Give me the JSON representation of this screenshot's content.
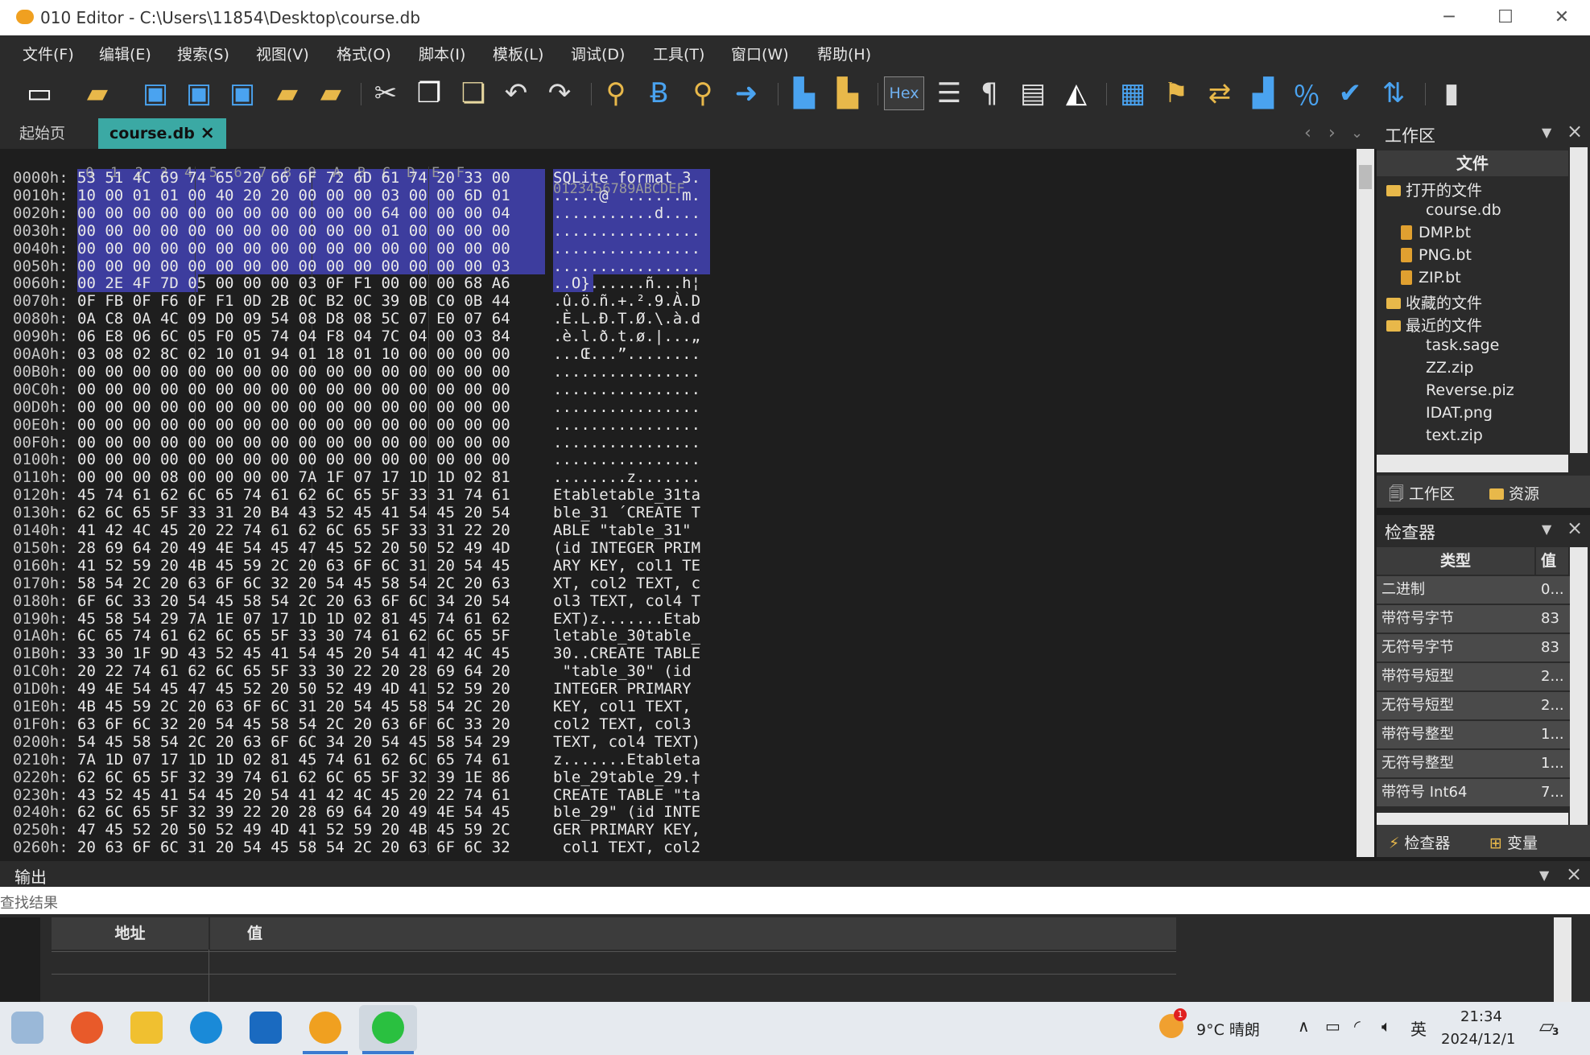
{
  "window": {
    "title": "010 Editor - C:\\Users\\11854\\Desktop\\course.db"
  },
  "menu": [
    "文件(F)",
    "编辑(E)",
    "搜索(S)",
    "视图(V)",
    "格式(O)",
    "脚本(I)",
    "模板(L)",
    "调试(D)",
    "工具(T)",
    "窗口(W)",
    "帮助(H)"
  ],
  "toolbar": {
    "hex_label": "Hex"
  },
  "tabs": {
    "start": "起始页",
    "active": "course.db",
    "close_glyph": "×"
  },
  "hex": {
    "header_bytes": " 0  1  2  3  4  5  6  7  8  9  A  B  C  D  E  F",
    "header_ascii": "0123456789ABCDEF",
    "rows": [
      {
        "a": "0000h:",
        "h": "53 51 4C 69 74 65 20 66 6F 72 6D 61 74 20 33 00",
        "t": "SQLite format 3."
      },
      {
        "a": "0010h:",
        "h": "10 00 01 01 00 40 20 20 00 00 00 03 00 00 6D 01",
        "t": ".....@  ......m."
      },
      {
        "a": "0020h:",
        "h": "00 00 00 00 00 00 00 00 00 00 00 64 00 00 00 04",
        "t": "...........d...."
      },
      {
        "a": "0030h:",
        "h": "00 00 00 00 00 00 00 00 00 00 00 01 00 00 00 00",
        "t": "................"
      },
      {
        "a": "0040h:",
        "h": "00 00 00 00 00 00 00 00 00 00 00 00 00 00 00 00",
        "t": "................"
      },
      {
        "a": "0050h:",
        "h": "00 00 00 00 00 00 00 00 00 00 00 00 00 00 00 03",
        "t": "................"
      },
      {
        "a": "0060h:",
        "h": "00 2E 4F 7D 05 00 00 00 03 0F F1 00 00 00 68 A6",
        "t": "..O}......ñ...h¦"
      },
      {
        "a": "0070h:",
        "h": "0F FB 0F F6 0F F1 0D 2B 0C B2 0C 39 0B C0 0B 44",
        "t": ".û.ö.ñ.+.².9.À.D"
      },
      {
        "a": "0080h:",
        "h": "0A C8 0A 4C 09 D0 09 54 08 D8 08 5C 07 E0 07 64",
        "t": ".È.L.Ð.T.Ø.\\.à.d"
      },
      {
        "a": "0090h:",
        "h": "06 E8 06 6C 05 F0 05 74 04 F8 04 7C 04 00 03 84",
        "t": ".è.l.ð.t.ø.|...„"
      },
      {
        "a": "00A0h:",
        "h": "03 08 02 8C 02 10 01 94 01 18 01 10 00 00 00 00",
        "t": "...Œ...”........"
      },
      {
        "a": "00B0h:",
        "h": "00 00 00 00 00 00 00 00 00 00 00 00 00 00 00 00",
        "t": "................"
      },
      {
        "a": "00C0h:",
        "h": "00 00 00 00 00 00 00 00 00 00 00 00 00 00 00 00",
        "t": "................"
      },
      {
        "a": "00D0h:",
        "h": "00 00 00 00 00 00 00 00 00 00 00 00 00 00 00 00",
        "t": "................"
      },
      {
        "a": "00E0h:",
        "h": "00 00 00 00 00 00 00 00 00 00 00 00 00 00 00 00",
        "t": "................"
      },
      {
        "a": "00F0h:",
        "h": "00 00 00 00 00 00 00 00 00 00 00 00 00 00 00 00",
        "t": "................"
      },
      {
        "a": "0100h:",
        "h": "00 00 00 00 00 00 00 00 00 00 00 00 00 00 00 00",
        "t": "................"
      },
      {
        "a": "0110h:",
        "h": "00 00 00 08 00 00 00 00 7A 1F 07 17 1D 1D 02 81",
        "t": "........z......."
      },
      {
        "a": "0120h:",
        "h": "45 74 61 62 6C 65 74 61 62 6C 65 5F 33 31 74 61",
        "t": "Etabletable_31ta"
      },
      {
        "a": "0130h:",
        "h": "62 6C 65 5F 33 31 20 B4 43 52 45 41 54 45 20 54",
        "t": "ble_31 ´CREATE T"
      },
      {
        "a": "0140h:",
        "h": "41 42 4C 45 20 22 74 61 62 6C 65 5F 33 31 22 20",
        "t": "ABLE \"table_31\" "
      },
      {
        "a": "0150h:",
        "h": "28 69 64 20 49 4E 54 45 47 45 52 20 50 52 49 4D",
        "t": "(id INTEGER PRIM"
      },
      {
        "a": "0160h:",
        "h": "41 52 59 20 4B 45 59 2C 20 63 6F 6C 31 20 54 45",
        "t": "ARY KEY, col1 TE"
      },
      {
        "a": "0170h:",
        "h": "58 54 2C 20 63 6F 6C 32 20 54 45 58 54 2C 20 63",
        "t": "XT, col2 TEXT, c"
      },
      {
        "a": "0180h:",
        "h": "6F 6C 33 20 54 45 58 54 2C 20 63 6F 6C 34 20 54",
        "t": "ol3 TEXT, col4 T"
      },
      {
        "a": "0190h:",
        "h": "45 58 54 29 7A 1E 07 17 1D 1D 02 81 45 74 61 62",
        "t": "EXT)z.......Etab"
      },
      {
        "a": "01A0h:",
        "h": "6C 65 74 61 62 6C 65 5F 33 30 74 61 62 6C 65 5F",
        "t": "letable_30table_"
      },
      {
        "a": "01B0h:",
        "h": "33 30 1F 9D 43 52 45 41 54 45 20 54 41 42 4C 45",
        "t": "30..CREATE TABLE"
      },
      {
        "a": "01C0h:",
        "h": "20 22 74 61 62 6C 65 5F 33 30 22 20 28 69 64 20",
        "t": " \"table_30\" (id "
      },
      {
        "a": "01D0h:",
        "h": "49 4E 54 45 47 45 52 20 50 52 49 4D 41 52 59 20",
        "t": "INTEGER PRIMARY "
      },
      {
        "a": "01E0h:",
        "h": "4B 45 59 2C 20 63 6F 6C 31 20 54 45 58 54 2C 20",
        "t": "KEY, col1 TEXT, "
      },
      {
        "a": "01F0h:",
        "h": "63 6F 6C 32 20 54 45 58 54 2C 20 63 6F 6C 33 20",
        "t": "col2 TEXT, col3 "
      },
      {
        "a": "0200h:",
        "h": "54 45 58 54 2C 20 63 6F 6C 34 20 54 45 58 54 29",
        "t": "TEXT, col4 TEXT)"
      },
      {
        "a": "0210h:",
        "h": "7A 1D 07 17 1D 1D 02 81 45 74 61 62 6C 65 74 61",
        "t": "z.......Etableta"
      },
      {
        "a": "0220h:",
        "h": "62 6C 65 5F 32 39 74 61 62 6C 65 5F 32 39 1E 86",
        "t": "ble_29table_29.†"
      },
      {
        "a": "0230h:",
        "h": "43 52 45 41 54 45 20 54 41 42 4C 45 20 22 74 61",
        "t": "CREATE TABLE \"ta"
      },
      {
        "a": "0240h:",
        "h": "62 6C 65 5F 32 39 22 20 28 69 64 20 49 4E 54 45",
        "t": "ble_29\" (id INTE"
      },
      {
        "a": "0250h:",
        "h": "47 45 52 20 50 52 49 4D 41 52 59 20 4B 45 59 2C",
        "t": "GER PRIMARY KEY,"
      },
      {
        "a": "0260h:",
        "h": "20 63 6F 6C 31 20 54 45 58 54 2C 20 63 6F 6C 32",
        "t": " col1 TEXT, col2"
      }
    ]
  },
  "workspace": {
    "title": "工作区",
    "header": "文件",
    "open_files_label": "打开的文件",
    "open_files": [
      "course.db",
      "DMP.bt",
      "PNG.bt",
      "ZIP.bt"
    ],
    "favorites_label": "收藏的文件",
    "recent_label": "最近的文件",
    "recent": [
      "task.sage",
      "ZZ.zip",
      "Reverse.piz",
      "IDAT.png",
      "text.zip"
    ],
    "tab_workspace": "工作区",
    "tab_resources": "资源"
  },
  "inspector": {
    "title": "检查器",
    "col_type": "类型",
    "col_value": "值",
    "rows": [
      {
        "type": "二进制",
        "value": "0..."
      },
      {
        "type": "带符号字节",
        "value": "83"
      },
      {
        "type": "无符号字节",
        "value": "83"
      },
      {
        "type": "带符号短型",
        "value": "2..."
      },
      {
        "type": "无符号短型",
        "value": "2..."
      },
      {
        "type": "带符号整型",
        "value": "1..."
      },
      {
        "type": "无符号整型",
        "value": "1..."
      },
      {
        "type": "带符号 Int64",
        "value": "7..."
      }
    ],
    "tab_inspector": "检查器",
    "tab_variables": "变量"
  },
  "output": {
    "title": "输出",
    "find_results": "查找结果",
    "col_address": "地址",
    "col_value": "值"
  },
  "taskbar": {
    "weather": "9°C  晴朗",
    "weather_badge": "1",
    "ime": "英",
    "time": "21:34",
    "date": "2024/12/1",
    "notif_count": "3"
  }
}
